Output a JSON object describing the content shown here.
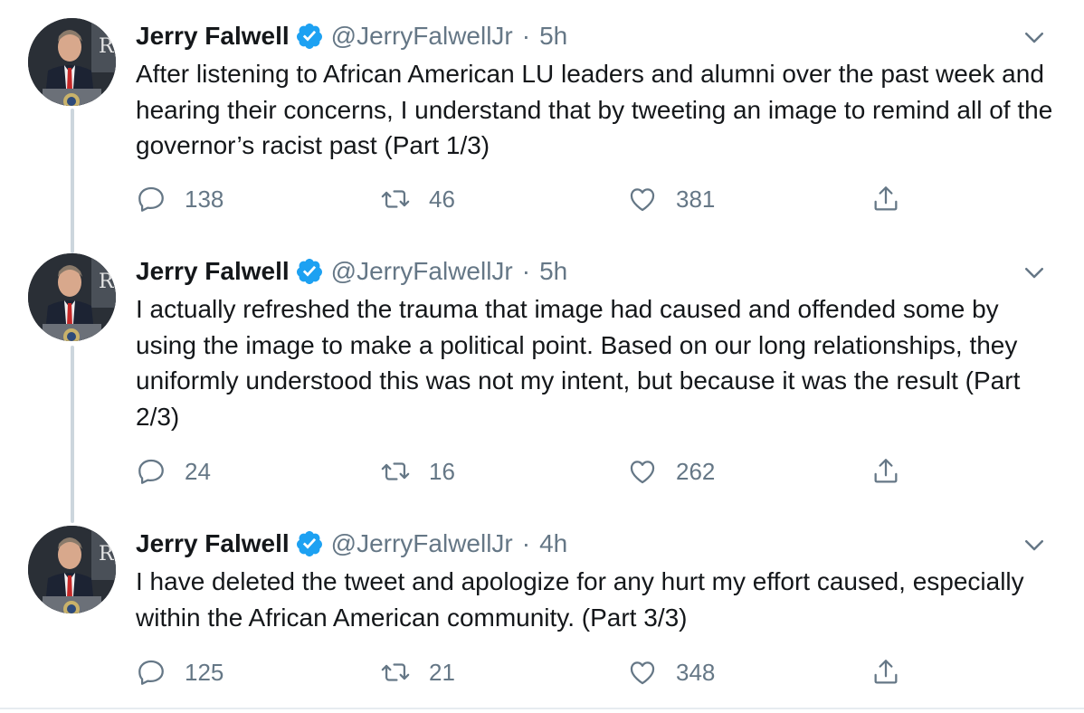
{
  "thread": {
    "tweets": [
      {
        "name": "Jerry Falwell",
        "handle": "@JerryFalwellJr",
        "separator": "·",
        "time": "5h",
        "text": "After listening to African American LU leaders and alumni over the past week and hearing their concerns, I understand that by tweeting an image to remind all of the governor’s racist past (Part 1/3)",
        "replies": "138",
        "retweets": "46",
        "likes": "381"
      },
      {
        "name": "Jerry Falwell",
        "handle": "@JerryFalwellJr",
        "separator": "·",
        "time": "5h",
        "text": "I actually refreshed the trauma that image had caused and offended some by using the image to make a political point. Based on our long relationships, they uniformly understood this was not my intent, but because it was the result (Part 2/3)",
        "replies": "24",
        "retweets": "16",
        "likes": "262"
      },
      {
        "name": "Jerry Falwell",
        "handle": "@JerryFalwellJr",
        "separator": "·",
        "time": "4h",
        "text": "I have deleted the tweet and apologize for any hurt my effort caused, especially within the African American community. (Part 3/3)",
        "replies": "125",
        "retweets": "21",
        "likes": "348"
      }
    ]
  },
  "colors": {
    "text": "#14171a",
    "secondary": "#657786",
    "verified": "#1da1f2",
    "thread_line": "#ccd6dd",
    "divider": "#e6ecf0"
  },
  "icons": {
    "verified": "verified-badge-icon",
    "caret": "chevron-down-icon",
    "reply": "reply-icon",
    "retweet": "retweet-icon",
    "like": "heart-icon",
    "share": "share-icon"
  }
}
